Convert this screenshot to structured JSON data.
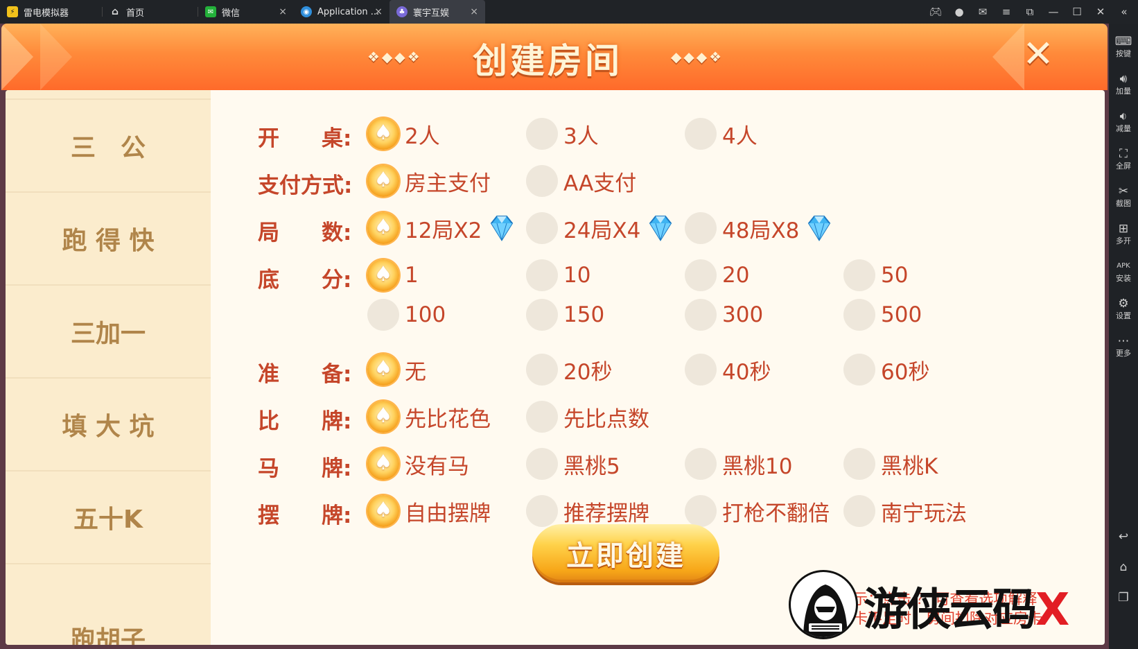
{
  "tabs": [
    {
      "label": "雷电模拟器",
      "icon": "leidian-logo-icon",
      "active": false
    },
    {
      "label": "首页",
      "icon": "home-icon",
      "active": false
    },
    {
      "label": "微信",
      "icon": "wechat-icon",
      "active": false
    },
    {
      "label": "Application ...",
      "icon": "globe-icon",
      "active": false
    },
    {
      "label": "寰宇互娱",
      "icon": "game-app-icon",
      "active": true
    }
  ],
  "window_controls": [
    "gamepad-icon",
    "account-icon",
    "mail-icon",
    "menu-icon",
    "restore-window-icon",
    "minimize-icon",
    "maximize-icon",
    "close-icon",
    "collapse-sidebar-icon"
  ],
  "toolbar": [
    {
      "label": "按键",
      "icon": "keyboard-icon"
    },
    {
      "label": "加量",
      "icon": "volume-up-icon"
    },
    {
      "label": "减量",
      "icon": "volume-down-icon"
    },
    {
      "label": "全屏",
      "icon": "fullscreen-icon"
    },
    {
      "label": "截图",
      "icon": "scissors-icon"
    },
    {
      "label": "多开",
      "icon": "multi-instance-icon"
    },
    {
      "label": "安装",
      "icon": "apk-install-icon"
    },
    {
      "label": "设置",
      "icon": "settings-gear-icon"
    },
    {
      "label": "更多",
      "icon": "more-icon"
    }
  ],
  "nav_buttons": [
    "back-icon",
    "home-nav-icon",
    "recent-apps-icon"
  ],
  "dialog": {
    "title": "创建房间",
    "create_button": "立即创建",
    "tip_line1": "温馨提示：点击 ？ 可查看选项解释",
    "tip_line2": "注：房卡不足时，房间扣除对应房卡"
  },
  "game_list": [
    "三　公",
    "跑 得 快",
    "三加一",
    "填 大 坑",
    "五十K",
    "跑胡子"
  ],
  "active_game": "三　公",
  "rows": [
    {
      "label_a": "开",
      "label_b": "桌:",
      "options": [
        {
          "text": "2人",
          "selected": true
        },
        {
          "text": "3人",
          "selected": false
        },
        {
          "text": "4人",
          "selected": false
        }
      ]
    },
    {
      "label_a": "支付方式:",
      "label_b": "",
      "options": [
        {
          "text": "房主支付",
          "selected": true
        },
        {
          "text": "AA支付",
          "selected": false
        }
      ]
    },
    {
      "label_a": "局",
      "label_b": "数:",
      "options": [
        {
          "text": "12局X2",
          "selected": true,
          "gem": true
        },
        {
          "text": "24局X4",
          "selected": false,
          "gem": true
        },
        {
          "text": "48局X8",
          "selected": false,
          "gem": true
        }
      ]
    },
    {
      "label_a": "底",
      "label_b": "分:",
      "options": [
        {
          "text": "1",
          "selected": true
        },
        {
          "text": "10",
          "selected": false
        },
        {
          "text": "20",
          "selected": false
        },
        {
          "text": "50",
          "selected": false
        },
        {
          "text": "100",
          "selected": false
        },
        {
          "text": "150",
          "selected": false
        },
        {
          "text": "300",
          "selected": false
        },
        {
          "text": "500",
          "selected": false
        }
      ]
    },
    {
      "label_a": "准",
      "label_b": "备:",
      "options": [
        {
          "text": "无",
          "selected": true
        },
        {
          "text": "20秒",
          "selected": false
        },
        {
          "text": "40秒",
          "selected": false
        },
        {
          "text": "60秒",
          "selected": false
        }
      ]
    },
    {
      "label_a": "比",
      "label_b": "牌:",
      "options": [
        {
          "text": "先比花色",
          "selected": true
        },
        {
          "text": "先比点数",
          "selected": false
        }
      ]
    },
    {
      "label_a": "马",
      "label_b": "牌:",
      "options": [
        {
          "text": "没有马",
          "selected": true
        },
        {
          "text": "黑桃5",
          "selected": false
        },
        {
          "text": "黑桃10",
          "selected": false
        },
        {
          "text": "黑桃K",
          "selected": false
        }
      ]
    },
    {
      "label_a": "摆",
      "label_b": "牌:",
      "options": [
        {
          "text": "自由摆牌",
          "selected": true
        },
        {
          "text": "推荐摆牌",
          "selected": false
        },
        {
          "text": "打枪不翻倍",
          "selected": false
        },
        {
          "text": "南宁玩法",
          "selected": false
        }
      ]
    }
  ],
  "watermark": {
    "text": "游侠云码",
    "mark": "X"
  },
  "colors": {
    "accent": "#c5462a",
    "header": "#ff8a3a",
    "sidebar": "#fbeccd",
    "radio_on": "#f6a321",
    "tip": "#e0402e"
  }
}
